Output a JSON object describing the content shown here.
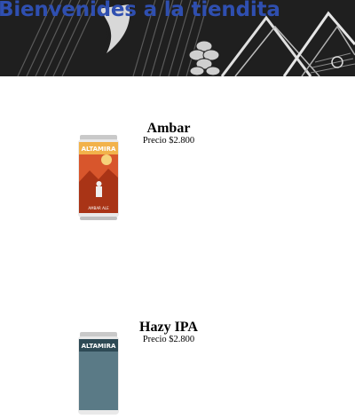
{
  "header": {
    "title": "Bienvenides a la tiendita"
  },
  "products": [
    {
      "name": "Ambar",
      "price": "Precio $2.800",
      "image_icon": "beer-can-ambar",
      "can_brand": "ALTAMIRA",
      "can_style": "AMBAR ALE",
      "accent": "#d0492a"
    },
    {
      "name": "Hazy IPA",
      "price": "Precio $2.800",
      "image_icon": "beer-can-hazy-ipa",
      "can_brand": "ALTAMIRA",
      "accent": "#5a7a86"
    }
  ]
}
